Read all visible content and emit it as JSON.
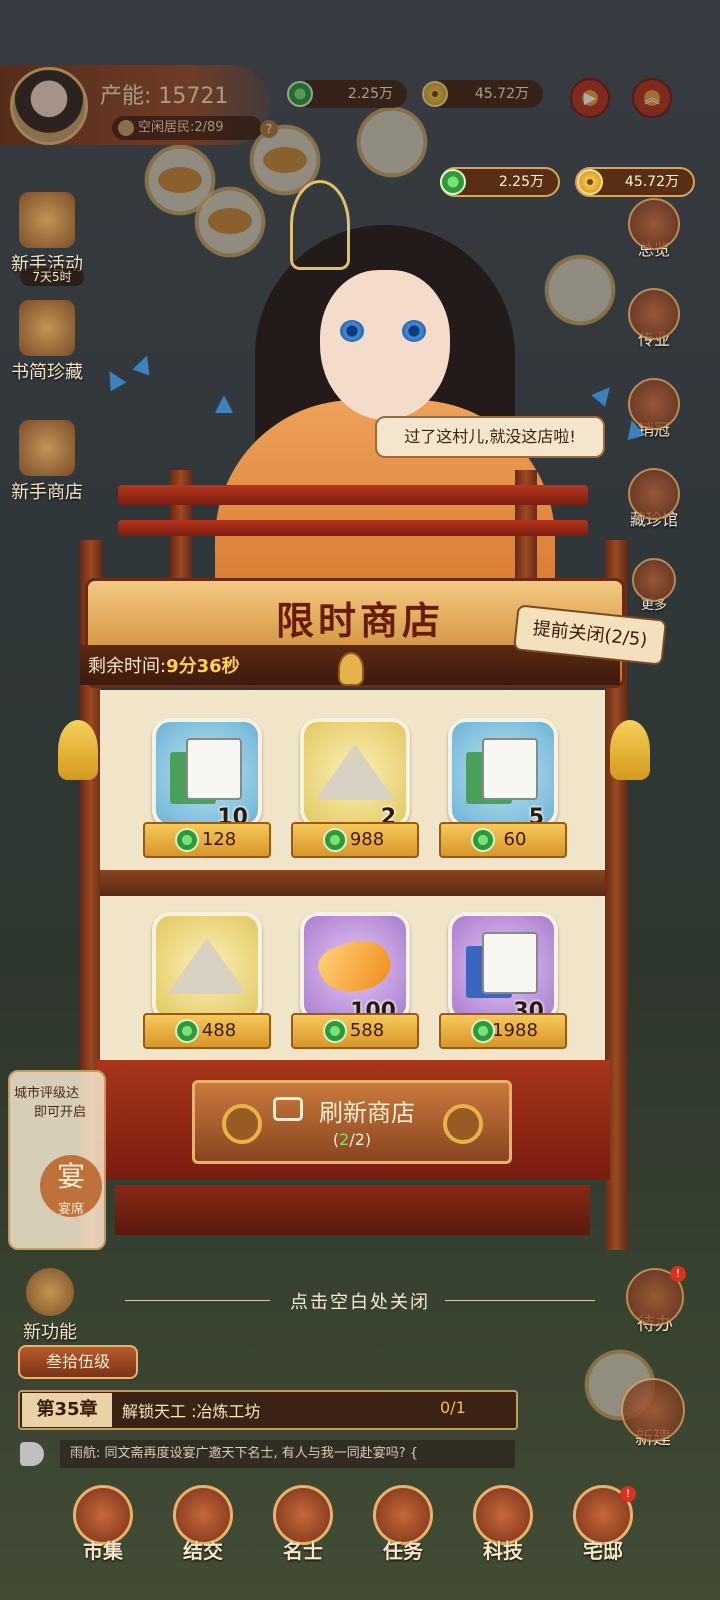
{
  "header": {
    "power": "产能: 15721",
    "idle_residents": "空闲居民:2/89",
    "help_icon": "?",
    "jade_amount": "2.25万",
    "coin_amount": "45.72万"
  },
  "popup_currency": {
    "jade_amount": "2.25万",
    "coin_amount": "45.72万"
  },
  "left_menu": {
    "newbie_event": "新手活动",
    "newbie_event_time": "7天5时",
    "book_treasure": "书简珍藏",
    "newbie_shop": "新手商店",
    "new_feature": "新功能"
  },
  "right_menu": {
    "overview": "总览",
    "legacy": "传业",
    "sales_champion": "销冠",
    "collection": "藏珍馆",
    "more": "更多",
    "todo": "待办",
    "build": "新建"
  },
  "speech": "过了这村儿,就没这店啦!",
  "shop": {
    "title": "限时商店",
    "time_label": "剩余时间:",
    "time_value": "9分36秒",
    "close_early": "提前关闭(2/5)",
    "items": [
      {
        "icon": "green-book-scroll-icon",
        "qty": "10",
        "price": "128",
        "bg": "blue"
      },
      {
        "icon": "tent-icon",
        "qty": "2",
        "price": "988",
        "bg": "yellow"
      },
      {
        "icon": "green-book-scroll-icon",
        "qty": "5",
        "price": "60",
        "bg": "blue"
      },
      {
        "icon": "tent-icon",
        "qty": "",
        "price": "488",
        "bg": "yellow"
      },
      {
        "icon": "gold-ore-icon",
        "qty": "100",
        "price": "588",
        "bg": "purple"
      },
      {
        "icon": "blue-book-scroll-icon",
        "qty": "30",
        "price": "1988",
        "bg": "purple"
      }
    ],
    "refresh_label": "刷新商店",
    "refresh_count_open": "(",
    "refresh_count_current": "2",
    "refresh_count_rest": "/2)"
  },
  "close_hint": "点击空白处关闭",
  "city_unlock": {
    "text": "城市评级达",
    "text2": "即可开启",
    "icon_char": "宴",
    "label": "宴席"
  },
  "level": "叁拾伍级",
  "chapter": {
    "number": "第35章",
    "task": "解锁天工 :冶炼工坊",
    "progress": "0/1"
  },
  "chat": "雨航: 同文斋再度设宴广邀天下名士, 有人与我一同赴宴吗? {",
  "bottom_nav": [
    "市集",
    "结交",
    "名士",
    "任务",
    "科技",
    "宅邸"
  ],
  "colors": {
    "accent_red": "#b8361e",
    "gold": "#f7c85a",
    "timer_highlight": "#ffd24a"
  }
}
